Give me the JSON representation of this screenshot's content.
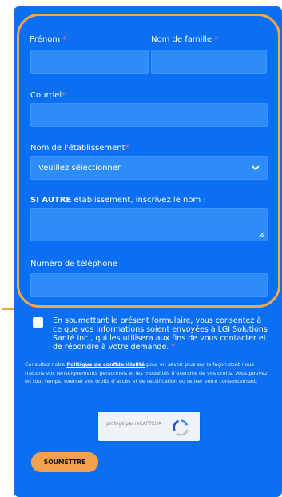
{
  "form": {
    "first_name": {
      "label": "Prénom",
      "required": "*"
    },
    "last_name": {
      "label": "Nom de famille",
      "required": "*"
    },
    "email": {
      "label": "Courriel",
      "required": "*"
    },
    "institution": {
      "label": "Nom de l'établissement",
      "required": "*",
      "selected": "Veuillez sélectionner"
    },
    "other": {
      "label_bold": "SI AUTRE",
      "label_rest": " établissement, inscrivez le nom :"
    },
    "phone": {
      "label": "Numéro de téléphone"
    },
    "consent": {
      "text": "En soumettant le présent formulaire, vous consentez à ce que vos informations soient envoyées à LGI Solutions Santé inc., qui les utilisera aux fins de vous contacter et de répondre à votre demande.",
      "required": "*"
    },
    "privacy": {
      "before": "Consultez notre ",
      "link": "Politique de confidentialité",
      "after": " pour en savoir plus sur la façon dont nous traitons vos renseignements personnels et les modalités d’exercice de vos droits. Vous pouvez, en tout temps, exercer vos droits d’accès et de rectification ou retirer votre consentement."
    },
    "recaptcha": "protégé par reCAPTCHA",
    "submit": "SOUMETTRE"
  },
  "colors": {
    "panel": "#0a6ff2",
    "field": "#2d8cf7",
    "accent": "#f4a14f",
    "required": "#ff6f6f"
  },
  "icons": {
    "dropdown": "chevron-down-icon",
    "captcha": "recaptcha-icon",
    "resize": "resize-grip-icon"
  }
}
